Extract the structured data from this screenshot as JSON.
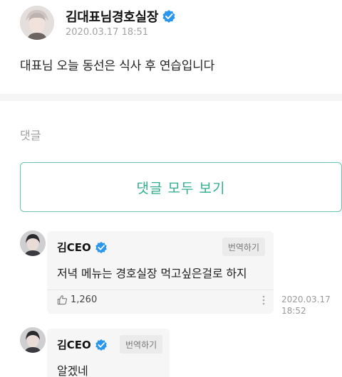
{
  "post": {
    "author": "김대표님경호실장",
    "date": "2020.03.17 18:51",
    "body": "대표님 오늘 동선은 식사 후 연습입니다"
  },
  "comments_section": {
    "title": "댓글",
    "view_all_label": "댓글 모두 보기"
  },
  "comments": [
    {
      "author": "김CEO",
      "translate_label": "번역하기",
      "text": "저녁 메뉴는 경호실장 먹고싶은걸로 하지",
      "likes": "1,260",
      "date_line1": "2020.03.17",
      "date_line2": "18:52"
    },
    {
      "author": "김CEO",
      "translate_label": "번역하기",
      "text": "알겠네"
    }
  ],
  "colors": {
    "accent": "#2fae8e",
    "verified": "#2b96ee"
  }
}
